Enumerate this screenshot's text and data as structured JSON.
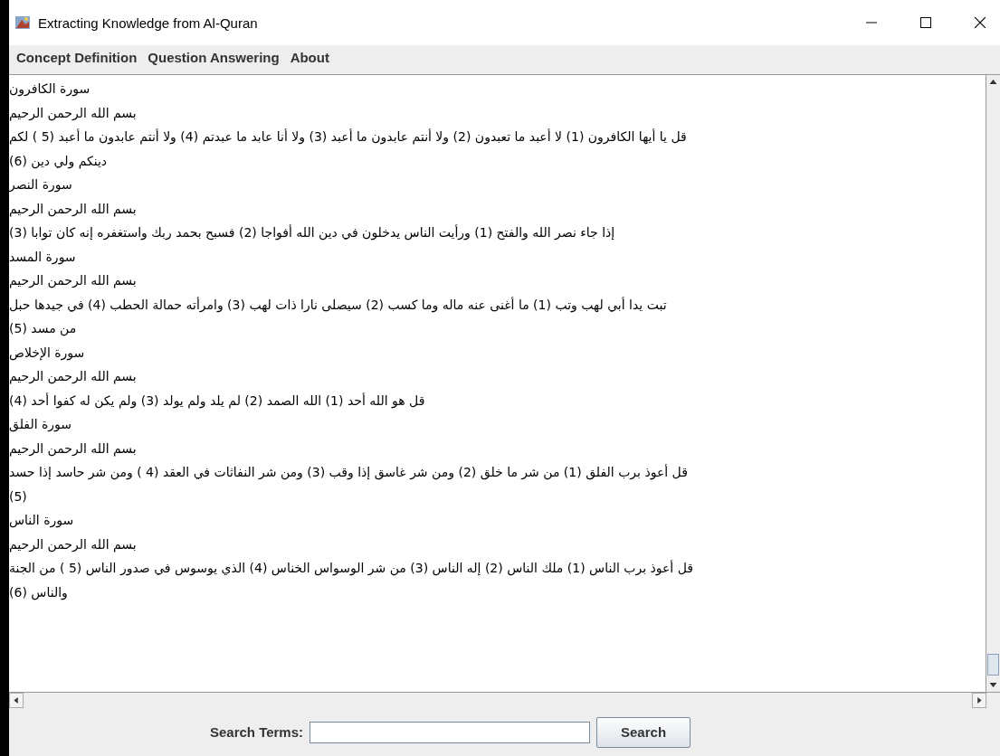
{
  "window": {
    "title": "Extracting Knowledge from Al-Quran"
  },
  "menu_bar": {
    "concept_definition": "Concept Definition",
    "question_answering": "Question Answering",
    "about": "About"
  },
  "text_area": {
    "lines": [
      "سورة الكافرون",
      "بسم الله الرحمن الرحيم",
      "قل يا أيها الكافرون (1) لا أعبد ما تعبدون (2) ولا أنتم عابدون ما أعبد (3) ولا أنا عابد ما عبدتم (4) ولا أنتم عابدون ما أعبد (5 ) لكم",
      "دينكم ولي دين (6)",
      "سورة النصر",
      "بسم الله الرحمن الرحيم",
      "إذا جاء نصر الله والفتح (1) ورأيت الناس يدخلون في دين الله أفواجا (2) فسبح بحمد ربك واستغفره إنه كان توابا (3)",
      "سورة المسد",
      "بسم الله الرحمن الرحيم",
      "تبت يدا أبي لهب وتب (1) ما أغنى عنه ماله وما كسب (2) سيصلى نارا ذات لهب (3) وامرأته حمالة الحطب (4) في جيدها حبل",
      "من مسد (5)",
      "سورة الإخلاص",
      "بسم الله الرحمن الرحيم",
      "قل هو الله أحد (1) الله الصمد (2) لم يلد ولم يولد (3) ولم يكن له كفوا أحد (4)",
      "سورة الفلق",
      "بسم الله الرحمن الرحيم",
      "قل أعوذ برب الفلق (1) من شر ما خلق (2) ومن شر غاسق إذا وقب (3) ومن شر النفاثات في العقد (4 ) ومن شر حاسد إذا حسد",
      "(5)",
      "سورة الناس",
      "بسم الله الرحمن الرحيم",
      "قل أعوذ برب الناس (1) ملك الناس (2) إله الناس (3) من شر الوسواس الخناس (4) الذي يوسوس في صدور الناس (5 ) من الجنة",
      "والناس (6)"
    ]
  },
  "search": {
    "label": "Search Terms:",
    "button": "Search"
  }
}
